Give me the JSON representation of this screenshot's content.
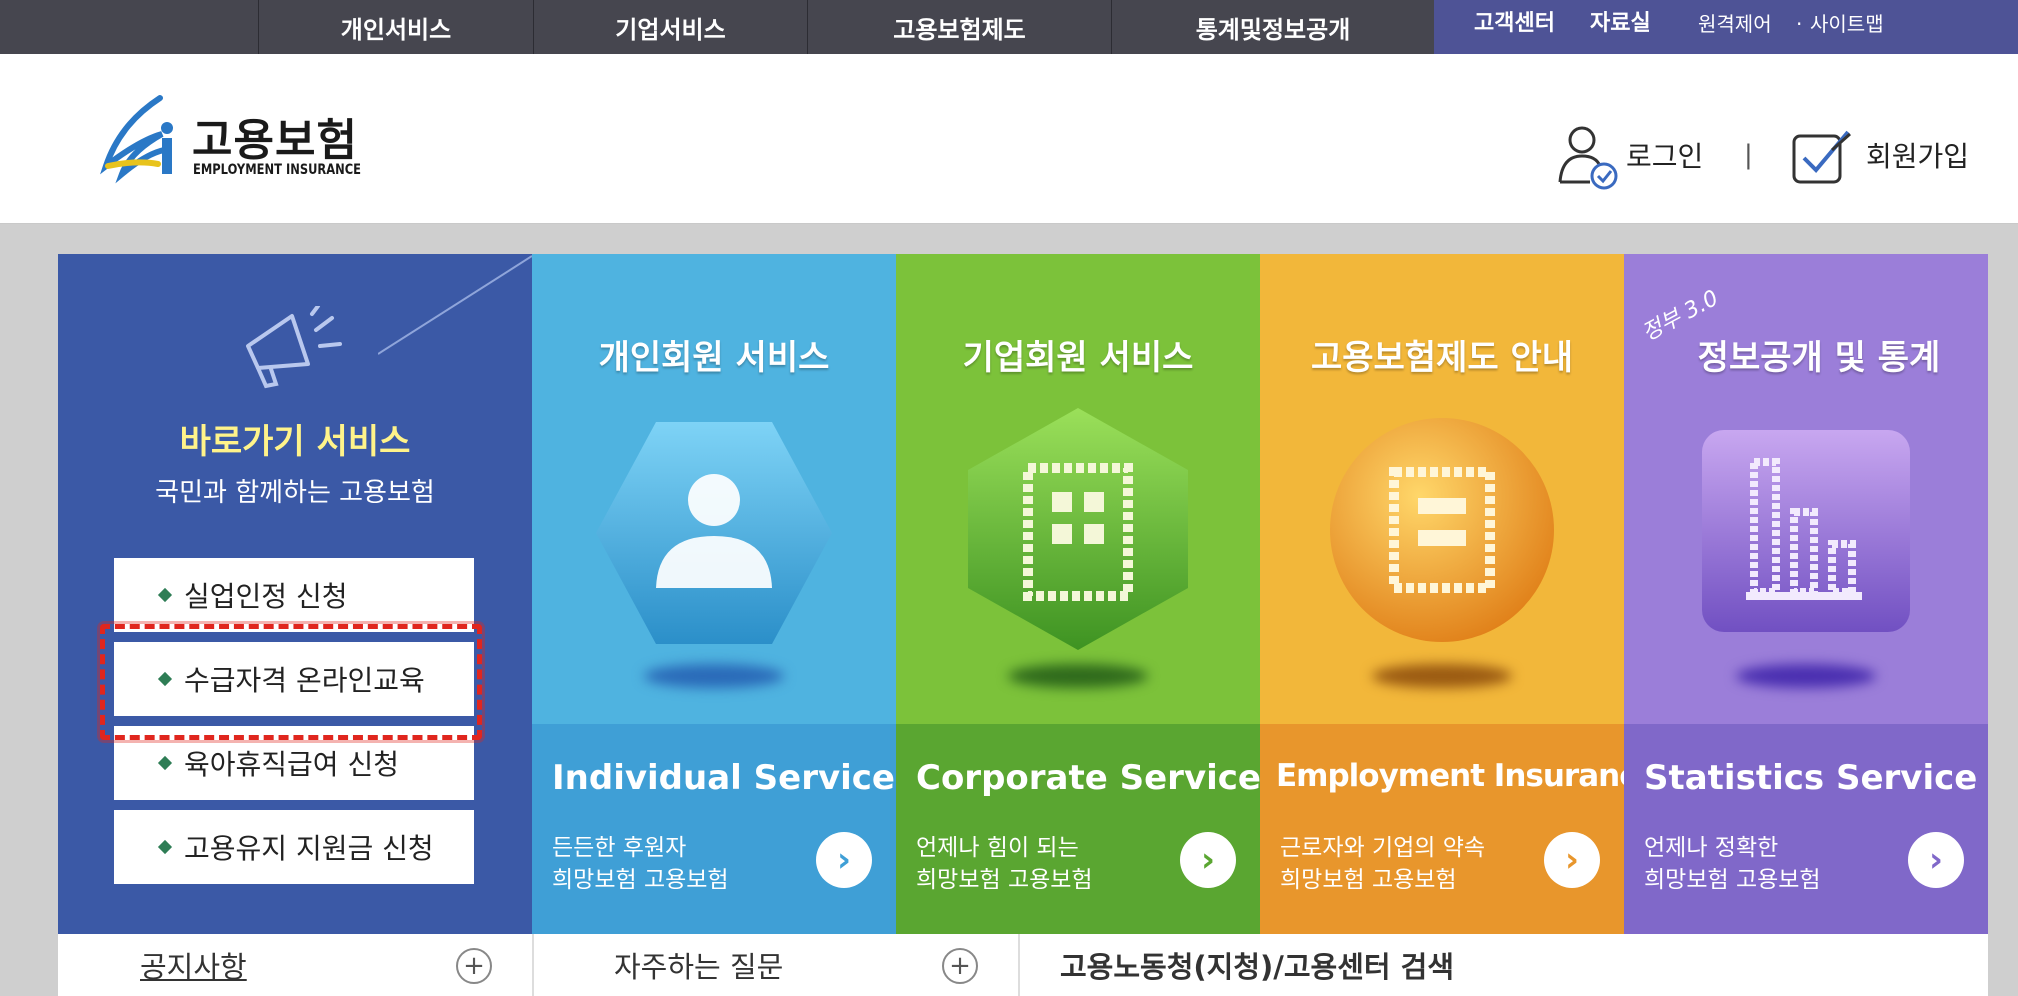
{
  "top_nav": {
    "items": [
      "개인서비스",
      "기업서비스",
      "고용보험제도",
      "통계및정보공개"
    ],
    "util": {
      "customer_center": "고객센터",
      "library": "자료실",
      "remote": "원격제어",
      "dot": "·",
      "sitemap": "사이트맵"
    }
  },
  "header": {
    "logo_ko": "고용보험",
    "logo_en": "EMPLOYMENT INSURANCE",
    "login": "로그인",
    "separator": "|",
    "signup": "회원가입"
  },
  "quick": {
    "title": "바로가기 서비스",
    "subtitle": "국민과 함께하는 고용보험",
    "items": [
      "실업인정 신청",
      "수급자격 온라인교육",
      "육아휴직급여 신청",
      "고용유지 지원금 신청"
    ]
  },
  "panels": [
    {
      "title": "개인회원 서비스",
      "en": "Individual Service",
      "line1": "든든한 후원자",
      "line2": "희망보험 고용보험",
      "icon": "person-icon",
      "color": "#4fb3e0",
      "lower_color": "#3f9fd6"
    },
    {
      "title": "기업회원 서비스",
      "en": "Corporate Service",
      "line1": "언제나 힘이 되는",
      "line2": "희망보험 고용보험",
      "icon": "building-icon",
      "color": "#7cc23a",
      "lower_color": "#5aa631"
    },
    {
      "title": "고용보험제도 안내",
      "en": "Employment Insurance",
      "line1": "근로자와 기업의 약속",
      "line2": "희망보험 고용보험",
      "icon": "document-icon",
      "color": "#f2b73a",
      "lower_color": "#e8962c"
    },
    {
      "title": "정보공개 및 통계",
      "badge": "정부 3.0",
      "en": "Statistics Service",
      "line1": "언제나 정확한",
      "line2": "희망보험 고용보험",
      "icon": "bar-chart-icon",
      "color": "#9b7ed9",
      "lower_color": "#8068c9"
    }
  ],
  "bottom": {
    "notice": "공지사항",
    "faq": "자주하는 질문",
    "search": "고용노동청(지청)/고용센터 검색",
    "plus": "+"
  },
  "colors": {
    "nav_bg": "#46464f",
    "util_bg": "#4e5396",
    "quick_bg": "#3b59a6",
    "highlight": "#e0261e"
  }
}
